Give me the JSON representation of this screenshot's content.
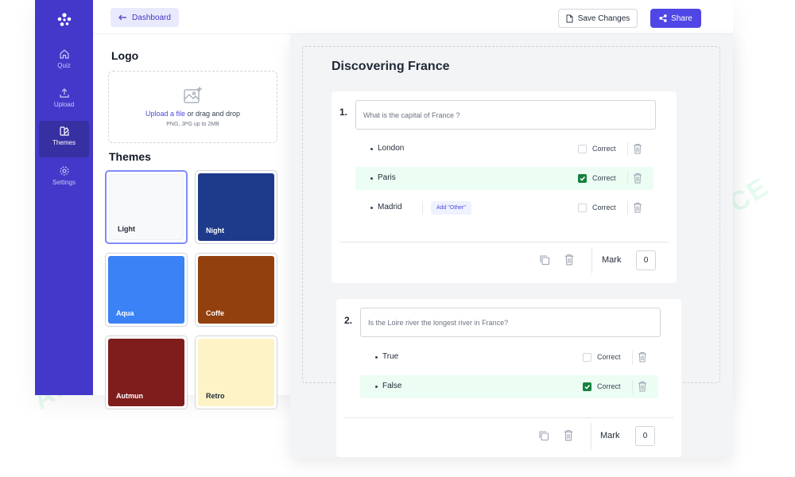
{
  "topbar": {
    "dashboard_label": "Dashboard",
    "save_label": "Save Changes",
    "share_label": "Share"
  },
  "sidebar": {
    "items": [
      {
        "label": "Quiz",
        "icon": "home-icon"
      },
      {
        "label": "Upload",
        "icon": "upload-icon"
      },
      {
        "label": "Themes",
        "icon": "palette-icon",
        "active": true
      },
      {
        "label": "Settings",
        "icon": "gear-icon"
      }
    ]
  },
  "panel": {
    "logo_heading": "Logo",
    "upload_link": "Upload a file",
    "upload_rest": " or drag and drop",
    "upload_hint": "PNG, JPG up to 2MB",
    "themes_heading": "Themes",
    "themes": [
      {
        "name": "Light",
        "color": "#f8f9fb",
        "text": "#1f2937",
        "selected": true
      },
      {
        "name": "Night",
        "color": "#1e3a8a",
        "text": "#ffffff"
      },
      {
        "name": "Aqua",
        "color": "#3b82f6",
        "text": "#ffffff"
      },
      {
        "name": "Coffe",
        "color": "#92400e",
        "text": "#ffffff"
      },
      {
        "name": "Autmun",
        "color": "#7f1d1d",
        "text": "#ffffff"
      },
      {
        "name": "Retro",
        "color": "#fef3c7",
        "text": "#1f2937"
      }
    ]
  },
  "quiz": {
    "title": "Discovering France",
    "questions": [
      {
        "number": "1.",
        "text": "What is the capital of France ?",
        "options": [
          {
            "text": "London",
            "correct": false
          },
          {
            "text": "Paris",
            "correct": true
          },
          {
            "text": "Madrid",
            "correct": false
          }
        ],
        "add_other_label": "Add \"Other\"",
        "mark_label": "Mark",
        "mark_value": "0"
      },
      {
        "number": "2.",
        "text": "Is the Loire river the longest river in France?",
        "options": [
          {
            "text": "True",
            "correct": false
          },
          {
            "text": "False",
            "correct": true
          }
        ],
        "mark_label": "Mark",
        "mark_value": "0"
      }
    ],
    "correct_label": "Correct"
  },
  "watermark": {
    "text": "AI TALENT SPACE",
    "color": "#86efac"
  }
}
